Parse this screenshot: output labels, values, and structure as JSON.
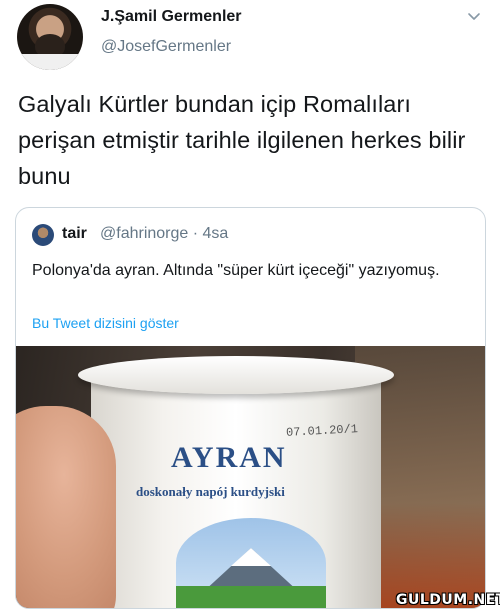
{
  "author": {
    "display_name": "J.Şamil Germenler",
    "handle": "@JosefGermenler"
  },
  "tweet": {
    "text": "Galyalı Kürtler bundan içip Romalıları perişan etmiştir tarihle ilgilenen herkes bilir bunu"
  },
  "quoted_tweet": {
    "name": "tair",
    "meta": "@fahrinorge · 4sa",
    "text": "Polonya'da ayran. Altında \"süper kürt içeceği\" yazıyomuş.",
    "thread_link": "Bu Tweet dizisini göster",
    "photo": {
      "brand": "AYRAN",
      "sub_label": "doskonały napój kurdyjski",
      "date_stamp": "07.01.20/1"
    }
  },
  "watermark": "GULDUM.NET",
  "icons": {
    "menu": "chevron-down-icon"
  },
  "colors": {
    "text": "#14171a",
    "secondary": "#657786",
    "link": "#1da1f2",
    "border": "#ccd6dd"
  }
}
